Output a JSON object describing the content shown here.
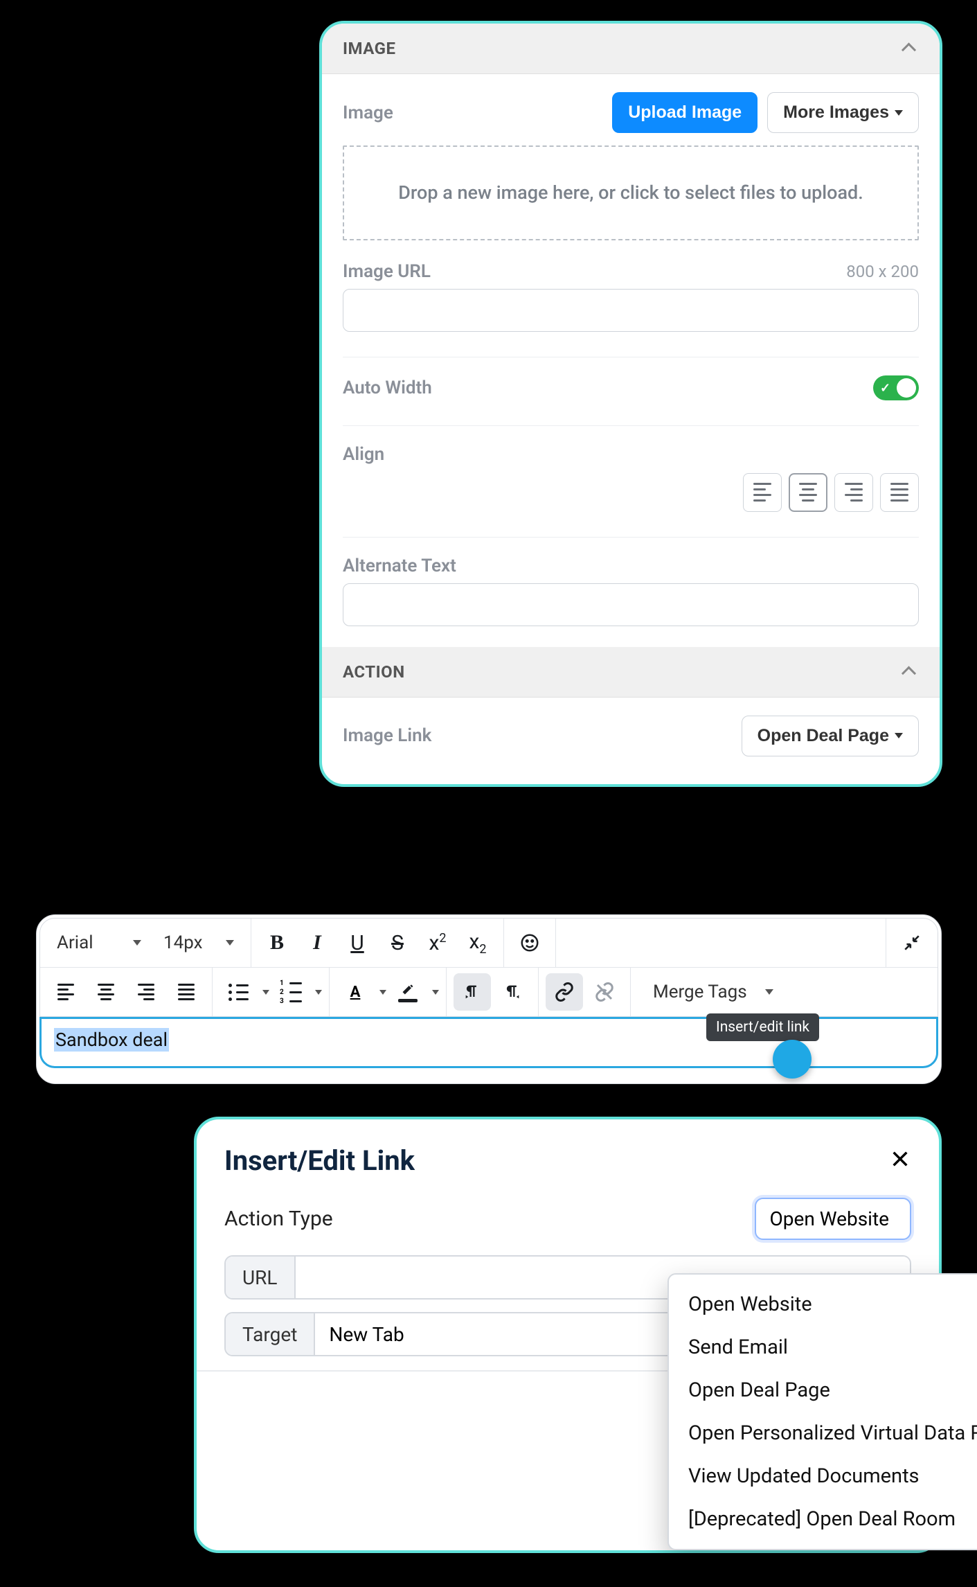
{
  "panel1": {
    "sections": {
      "image": {
        "header": "IMAGE",
        "image_label": "Image",
        "upload_btn": "Upload Image",
        "more_images_btn": "More Images",
        "dropzone_text": "Drop a new image here, or click to select files to upload.",
        "image_url_label": "Image URL",
        "image_dims": "800 x 200",
        "image_url_value": "",
        "auto_width_label": "Auto Width",
        "auto_width_on": true,
        "align_label": "Align",
        "align_selected_index": 1,
        "alt_text_label": "Alternate Text",
        "alt_text_value": ""
      },
      "action": {
        "header": "ACTION",
        "image_link_label": "Image Link",
        "image_link_value": "Open Deal Page"
      }
    }
  },
  "toolbar": {
    "font_family": "Arial",
    "font_size": "14px",
    "merge_tags_label": "Merge Tags",
    "tooltip": "Insert/edit link",
    "editor_text": "Sandbox deal"
  },
  "dialog": {
    "title": "Insert/Edit Link",
    "action_type_label": "Action Type",
    "action_type_value": "Open Website",
    "url_label": "URL",
    "url_value": "",
    "target_label": "Target",
    "target_value": "New Tab",
    "options": [
      "Open Website",
      "Send Email",
      "Open Deal Page",
      "Open Personalized Virtual Data Room",
      "View Updated Documents",
      "[Deprecated] Open Deal Room"
    ]
  }
}
